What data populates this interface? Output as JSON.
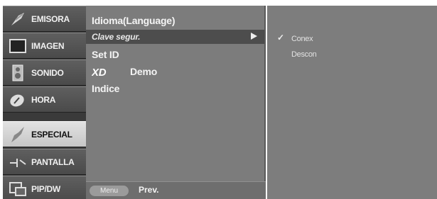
{
  "categories": [
    {
      "label": "EMISORA",
      "icon": "antenna-icon"
    },
    {
      "label": "IMAGEN",
      "icon": "picture-icon"
    },
    {
      "label": "SONIDO",
      "icon": "speaker-icon"
    },
    {
      "label": "HORA",
      "icon": "clock-icon"
    },
    {
      "label": "ESPECIAL",
      "icon": "special-icon",
      "selected": true
    },
    {
      "label": "PANTALLA",
      "icon": "screen-icon"
    },
    {
      "label": "PIP/DW",
      "icon": "pip-icon"
    }
  ],
  "submenu": {
    "items": [
      {
        "label": "Idioma(Language)"
      },
      {
        "label": "Clave segur.",
        "highlighted": true
      },
      {
        "label": "Set ID"
      },
      {
        "label": "Demo",
        "logo": "XD"
      },
      {
        "label": "Indice"
      }
    ]
  },
  "bottom": {
    "menu_button": "Menu",
    "prev_label": "Prev."
  },
  "options": {
    "check": "✓",
    "items": [
      {
        "label": "Conex",
        "selected": true
      },
      {
        "label": "Descon"
      }
    ]
  },
  "colors": {
    "panel": "#7c7c7c",
    "highlight": "#4d4d4d",
    "category_bg": "#555555",
    "category_selected": "#d4d4d4"
  }
}
